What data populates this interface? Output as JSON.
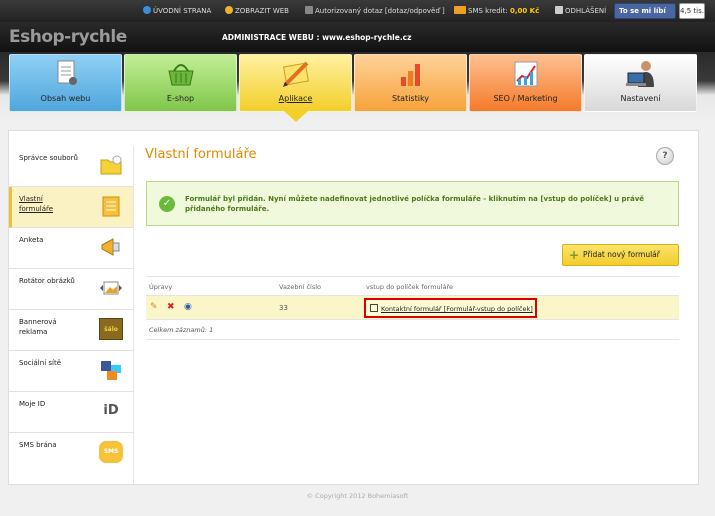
{
  "topbar": {
    "home": "ÚVODNÍ STRANA",
    "show_web": "ZOBRAZIT WEB",
    "query": "Autorizovaný dotaz [dotaz/odpověď ]",
    "sms_label": "SMS kredit:",
    "sms_value": "0,00 Kč",
    "logout": "ODHLÁŠENÍ",
    "fb_like": "To se mi líbí",
    "fb_count": "4,5 tis."
  },
  "header": {
    "logo": "Eshop-rychle",
    "admin_title": "ADMINISTRACE WEBU : www.eshop-rychle.cz"
  },
  "tabs": [
    {
      "label": "Obsah webu",
      "icon": "document-icon",
      "color": "#5fb0e2"
    },
    {
      "label": "E-shop",
      "icon": "basket-icon",
      "color": "#8fd05c"
    },
    {
      "label": "Aplikace",
      "icon": "pencil-ruler-icon",
      "color": "#f4d63c",
      "active": true
    },
    {
      "label": "Statistiky",
      "icon": "bar-chart-icon",
      "color": "#f7a23a"
    },
    {
      "label": "SEO / Marketing",
      "icon": "growth-chart-icon",
      "color": "#f47a2a"
    },
    {
      "label": "Nastavení",
      "icon": "user-laptop-icon",
      "color": "#d8d8d8"
    }
  ],
  "sidebar": [
    {
      "label": "Správce souborů",
      "icon": "folder-icon"
    },
    {
      "label": "Vlastní formuláře",
      "icon": "form-icon",
      "active": true
    },
    {
      "label": "Anketa",
      "icon": "megaphone-icon"
    },
    {
      "label": "Rotátor obrázků",
      "icon": "image-rotator-icon"
    },
    {
      "label": "Bannerová reklama",
      "icon": "banner-icon",
      "icon_text": "šálo"
    },
    {
      "label": "Sociální sítě",
      "icon": "social-icon"
    },
    {
      "label": "Moje ID",
      "icon": "mojeid-icon",
      "icon_text": "iD"
    },
    {
      "label": "SMS brána",
      "icon": "sms-icon",
      "icon_text": "SMS"
    }
  ],
  "main": {
    "title": "Vlastní formuláře",
    "help": "?",
    "message": "Formulář byl přidán. Nyní můžete nadefinovat jednotlivé políčka formuláře - kliknutím na [vstup do políček] u právě přidaného formuláře.",
    "add_button": "Přidat nový formulář",
    "columns": [
      "Úpravy",
      "Vazební číslo",
      "vstup do políček formuláře"
    ],
    "rows": [
      {
        "id": "33",
        "link": "Kontaktní formulář [Formulář-vstup do políček]"
      }
    ],
    "total": "Celkem záznamů: 1"
  },
  "footer": {
    "copyright": "© Copyright 2012 Bohemiasoft"
  }
}
